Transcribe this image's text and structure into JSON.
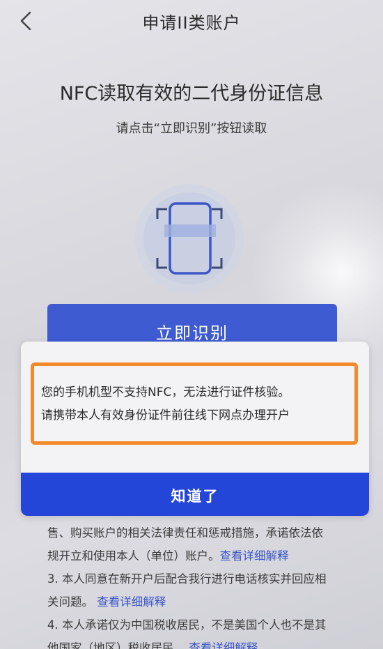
{
  "header": {
    "title": "申请II类账户"
  },
  "main": {
    "title": "NFC读取有效的二代身份证信息",
    "subtitle": "请点击“立即识别”按钮读取",
    "identify_button": "立即识别"
  },
  "dialog": {
    "line1": "您的手机机型不支持NFC，无法进行证件核验。",
    "line2": "请携带本人有效身份证件前往线下网点办理开户",
    "ok_button": "知道了"
  },
  "terms": {
    "line1": "售、购买账户的相关法律责任和惩戒措施，承诺依法依",
    "line2_text": "规开立和使用本人（单位）账户。",
    "line2_link": "查看详细解释",
    "line3": "3. 本人同意在新开户后配合我行进行电话核实并回应相",
    "line4_text": "关问题。",
    "line4_link": "查看详细解释",
    "line5": "4. 本人承诺仅为中国税收居民，不是美国个人也不是其",
    "line6_text": "他国家（地区）税收居民。",
    "line6_link": "查看详细解释"
  },
  "colors": {
    "primary_blue": "#2346d8",
    "button_blue": "#3f5bd2",
    "highlight_orange": "#f28a2a",
    "link_blue": "#3a56c7"
  },
  "icons": {
    "back": "chevron-left-icon",
    "nfc": "phone-scan-icon"
  }
}
